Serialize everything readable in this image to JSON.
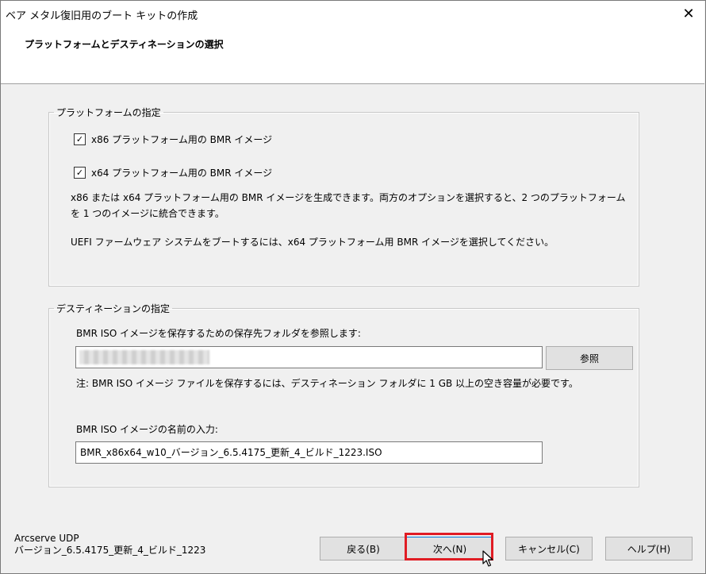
{
  "window": {
    "title": "ベア メタル復旧用のブート キットの作成",
    "close_glyph": "✕"
  },
  "header": {
    "title": "プラットフォームとデスティネーションの選択"
  },
  "platform_group": {
    "legend": "プラットフォームの指定",
    "x86_checkbox": {
      "label": "x86 プラットフォーム用の BMR イメージ",
      "checked": true
    },
    "x64_checkbox": {
      "label": "x64 プラットフォーム用の BMR イメージ",
      "checked": true
    },
    "info_line1": "x86 または x64 プラットフォーム用の BMR イメージを生成できます。両方のオプションを選択すると、2 つのプラットフォーム",
    "info_line2": "を 1 つのイメージに統合できます。",
    "uefi_note": "UEFI ファームウェア システムをブートするには、x64 プラットフォーム用 BMR イメージを選択してください。"
  },
  "destination_group": {
    "legend": "デスティネーションの指定",
    "folder_label": "BMR ISO イメージを保存するための保存先フォルダを参照します:",
    "folder_value": "",
    "browse_button": "参照",
    "space_note": "注: BMR ISO イメージ ファイルを保存するには、デスティネーション フォルダに 1 GB 以上の空き容量が必要です。",
    "name_label": "BMR ISO イメージの名前の入力:",
    "name_value": "BMR_x86x64_w10_バージョン_6.5.4175_更新_4_ビルド_1223.ISO"
  },
  "footer": {
    "product": "Arcserve UDP",
    "version": "バージョン_6.5.4175_更新_4_ビルド_1223",
    "back_button": "戻る(B)",
    "next_button": "次へ(N)",
    "cancel_button": "キャンセル(C)",
    "help_button": "ヘルプ(H)"
  },
  "colors": {
    "highlight": "#e01c24",
    "dialog_bg": "#f0f0f0"
  }
}
